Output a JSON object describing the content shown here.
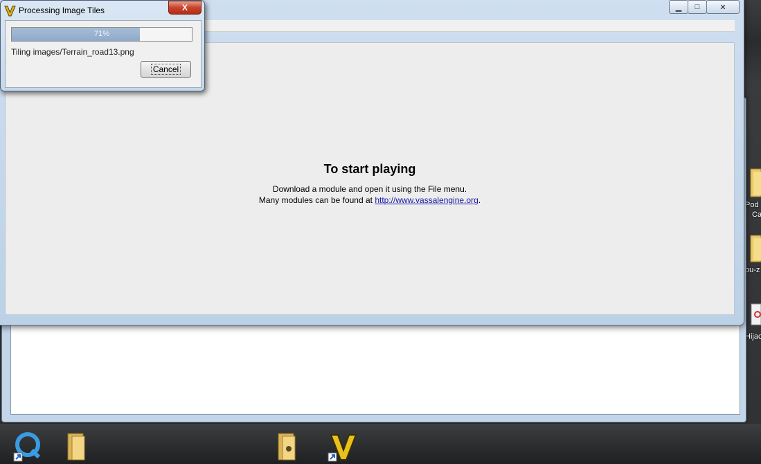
{
  "desktop": {
    "labels": [
      "Pod",
      "Ca",
      "ou-z",
      "Hijac"
    ]
  },
  "main_window": {
    "controls": {
      "minimize": "▁",
      "maximize": "□",
      "close": "✕"
    },
    "welcome": {
      "title": "To start playing",
      "line1": "Download a module and open it using the File menu.",
      "line2_prefix": "Many modules can be found at ",
      "link": "http://www.vassalengine.org",
      "line2_suffix": "."
    }
  },
  "dialog": {
    "title": "Processing Image Tiles",
    "close": "X",
    "progress": {
      "value": 0.71,
      "label": "71%"
    },
    "message": "Tiling images/Terrain_road13.png",
    "cancel_label": "Cancel"
  },
  "taskbar": {
    "items": [
      "quicktime-icon",
      "folder-icon",
      "folder-pin-icon",
      "vassal-icon"
    ]
  },
  "colors": {
    "accent": "#c9432a",
    "link": "#1a1aa6",
    "progress": "#8faacb"
  }
}
